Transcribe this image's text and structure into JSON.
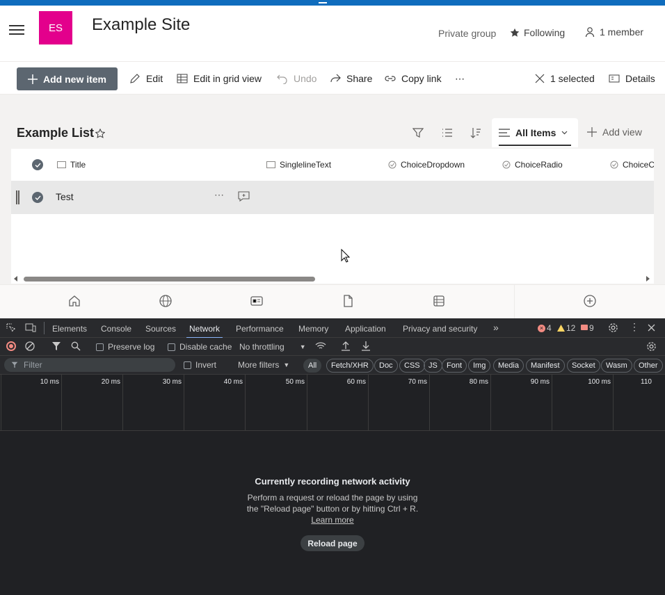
{
  "app": {
    "window_bar_color": "#0f6cbd"
  },
  "header": {
    "logo_initials": "ES",
    "logo_color": "#e3008c",
    "site_title": "Example Site",
    "privacy": "Private group",
    "following_label": "Following",
    "members_label": "1 member"
  },
  "toolbar": {
    "add_new_item": "Add new item",
    "edit": "Edit",
    "edit_grid": "Edit in grid view",
    "undo": "Undo",
    "share": "Share",
    "copy_link": "Copy link",
    "more": "⋯",
    "selected": "1 selected",
    "details": "Details"
  },
  "list": {
    "title": "Example List",
    "view_label": "All Items",
    "add_view": "Add view",
    "columns": [
      "Title",
      "SinglelineText",
      "ChoiceDropdown",
      "ChoiceRadio",
      "ChoiceC"
    ],
    "rows": [
      {
        "title": "Test"
      }
    ]
  },
  "devtools": {
    "tabs": [
      "Elements",
      "Console",
      "Sources",
      "Network",
      "Performance",
      "Memory",
      "Application",
      "Privacy and security"
    ],
    "active_tab": "Network",
    "errors": "4",
    "warnings": "12",
    "issues": "9",
    "preserve_log": "Preserve log",
    "disable_cache": "Disable cache",
    "throttling": "No throttling",
    "filter_placeholder": "Filter",
    "invert": "Invert",
    "more_filters": "More filters",
    "filter_types": [
      "All",
      "Fetch/XHR",
      "Doc",
      "CSS",
      "JS",
      "Font",
      "Img",
      "Media",
      "Manifest",
      "Socket",
      "Wasm",
      "Other"
    ],
    "timeline_ticks": [
      "10 ms",
      "20 ms",
      "30 ms",
      "40 ms",
      "50 ms",
      "60 ms",
      "70 ms",
      "80 ms",
      "90 ms",
      "100 ms",
      "110"
    ],
    "recording_title": "Currently recording network activity",
    "recording_body": "Perform a request or reload the page by using the \"Reload page\" button or by hitting Ctrl + R.",
    "learn_more": "Learn more",
    "reload_button": "Reload page"
  }
}
